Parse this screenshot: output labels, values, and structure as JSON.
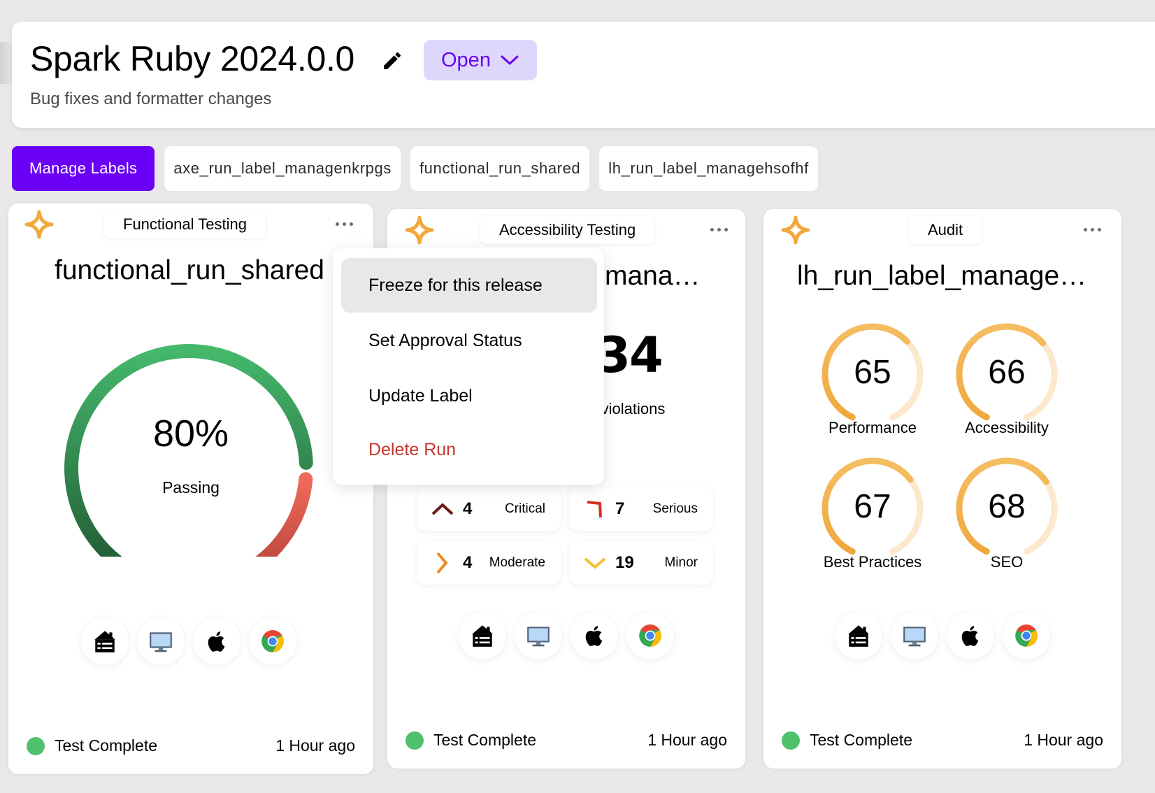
{
  "release": {
    "title": "Spark Ruby 2024.0.0",
    "subtitle": "Bug fixes and formatter changes",
    "status": "Open"
  },
  "labels": {
    "manage_label": "Manage Labels",
    "chips": [
      "axe_run_label_managenkrpgs",
      "functional_run_shared",
      "lh_run_label_managehsofhf"
    ]
  },
  "colors": {
    "accent": "#6a00f5",
    "pass_green": "#3bb36a",
    "fail_red": "#e2685a",
    "audit_orange": "#f2b04d",
    "status_complete": "#4fc16d",
    "danger": "#c4372f"
  },
  "cards": [
    {
      "type": "Functional Testing",
      "title": "functional_run_shared",
      "gauge": {
        "value": "80%",
        "caption": "Passing",
        "pass_fraction": 0.8
      },
      "platforms": [
        "server-icon",
        "desktop-icon",
        "apple-icon",
        "chrome-icon"
      ],
      "status": "Test Complete",
      "time": "1 Hour ago"
    },
    {
      "type": "Accessibility Testing",
      "title": "axe_run_label_managenkrpgs",
      "title_visible": "mana…",
      "total_violations": "34",
      "violations_caption": "l violations",
      "severity": [
        {
          "icon": "critical-icon",
          "count": "4",
          "label": "Critical",
          "color": "#6e1a14"
        },
        {
          "icon": "serious-icon",
          "count": "7",
          "label": "Serious",
          "color": "#d43020"
        },
        {
          "icon": "moderate-icon",
          "count": "4",
          "label": "Moderate",
          "color": "#ef8a22"
        },
        {
          "icon": "minor-icon",
          "count": "19",
          "label": "Minor",
          "color": "#f3c22f"
        }
      ],
      "platforms": [
        "server-icon",
        "desktop-icon",
        "apple-icon",
        "chrome-icon"
      ],
      "status": "Test Complete",
      "time": "1 Hour ago"
    },
    {
      "type": "Audit",
      "title": "lh_run_label_manage…",
      "scores": [
        {
          "value": "65",
          "label": "Performance",
          "fraction": 0.65
        },
        {
          "value": "66",
          "label": "Accessibility",
          "fraction": 0.66
        },
        {
          "value": "67",
          "label": "Best Practices",
          "fraction": 0.67
        },
        {
          "value": "68",
          "label": "SEO",
          "fraction": 0.68
        }
      ],
      "platforms": [
        "server-icon",
        "desktop-icon",
        "apple-icon",
        "chrome-icon"
      ],
      "status": "Test Complete",
      "time": "1 Hour ago"
    }
  ],
  "menu": {
    "items": [
      {
        "label": "Freeze for this release",
        "active": true
      },
      {
        "label": "Set Approval Status"
      },
      {
        "label": "Update Label"
      },
      {
        "label": "Delete Run",
        "danger": true
      }
    ]
  }
}
